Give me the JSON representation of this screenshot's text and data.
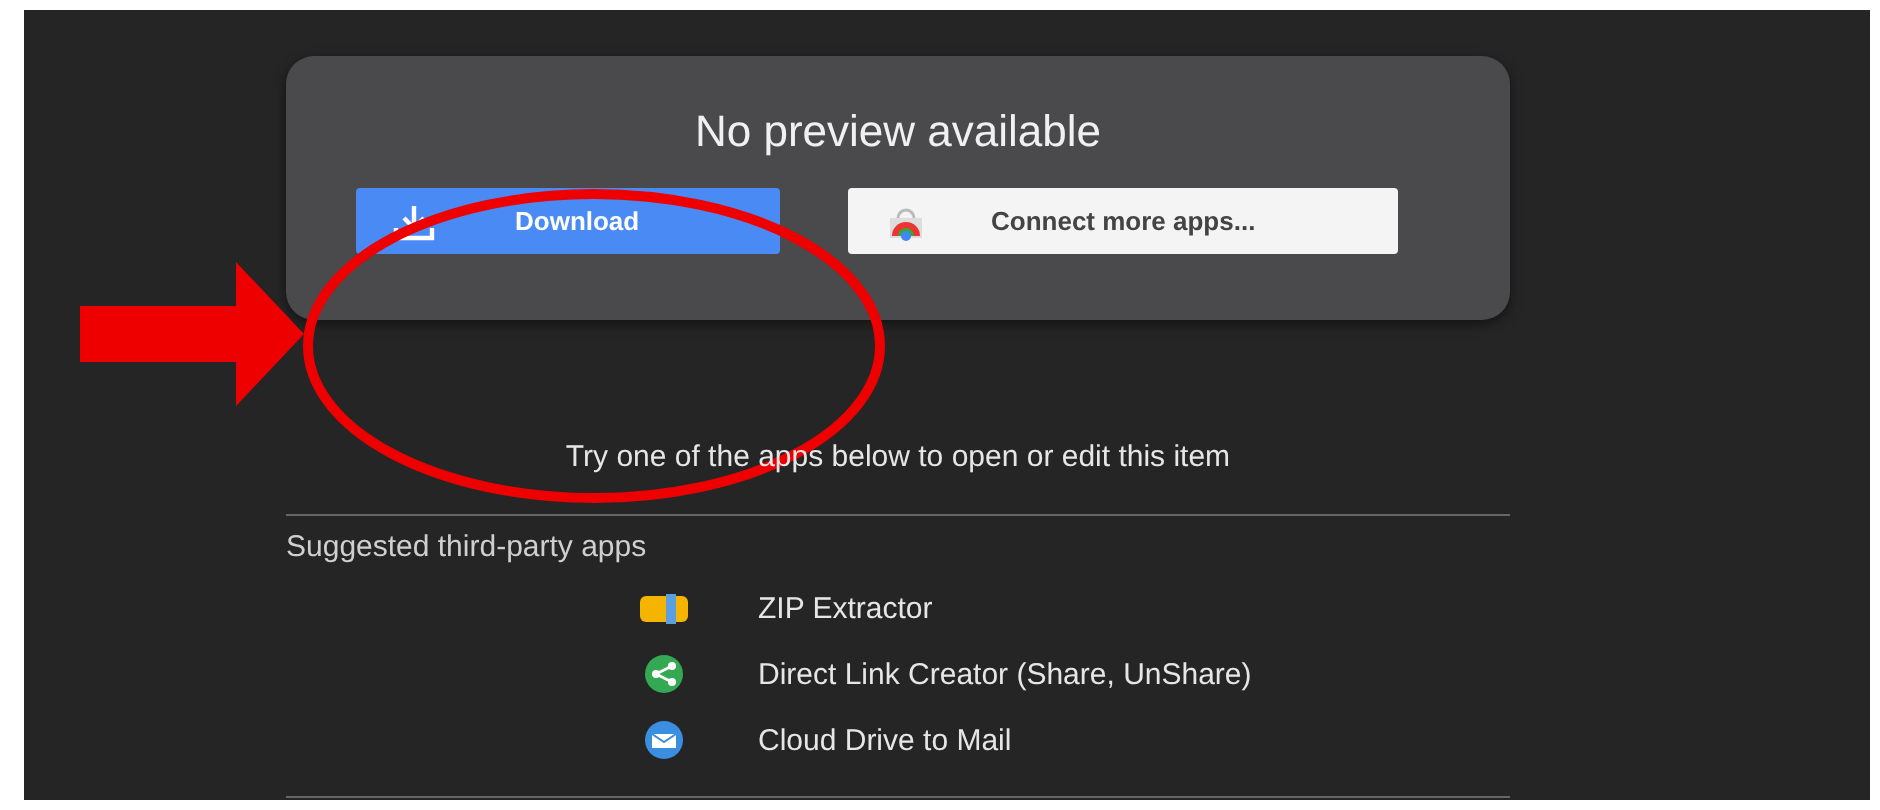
{
  "preview_card": {
    "title": "No preview available",
    "buttons": [
      {
        "kind": "download",
        "label": "Download"
      },
      {
        "kind": "connect",
        "label": "Connect more apps..."
      }
    ]
  },
  "hint": "Try one of the apps below to open or edit this item",
  "suggested": {
    "heading": "Suggested third-party apps",
    "apps": [
      {
        "kind": "zip",
        "label": "ZIP Extractor"
      },
      {
        "kind": "share",
        "label": "Direct Link Creator (Share, UnShare)"
      },
      {
        "kind": "mail",
        "label": "Cloud Drive to Mail"
      }
    ]
  }
}
